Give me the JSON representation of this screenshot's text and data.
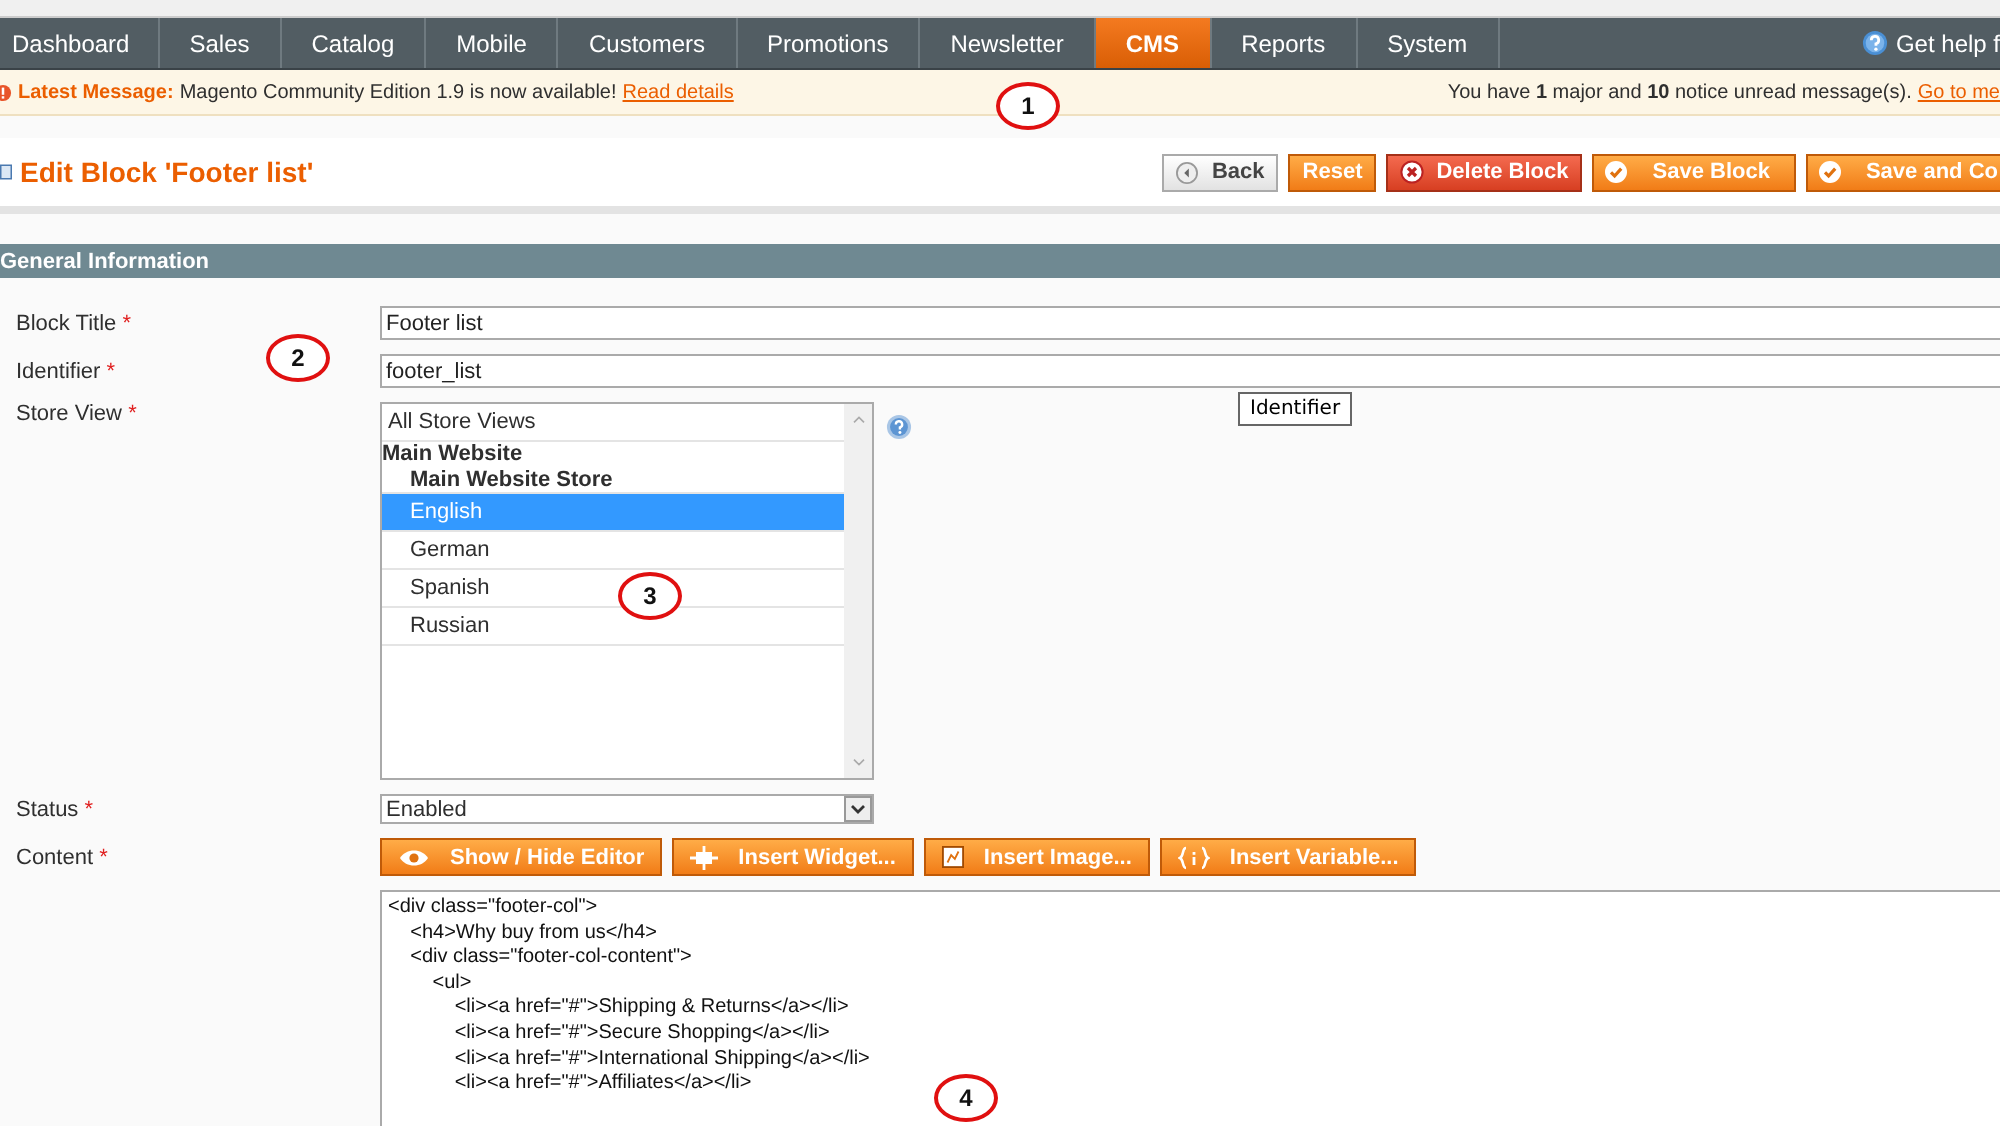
{
  "nav": {
    "items": [
      {
        "label": "Dashboard",
        "selected": false
      },
      {
        "label": "Sales",
        "selected": false
      },
      {
        "label": "Catalog",
        "selected": false
      },
      {
        "label": "Mobile",
        "selected": false
      },
      {
        "label": "Customers",
        "selected": false
      },
      {
        "label": "Promotions",
        "selected": false
      },
      {
        "label": "Newsletter",
        "selected": false
      },
      {
        "label": "CMS",
        "selected": true
      },
      {
        "label": "Reports",
        "selected": false
      },
      {
        "label": "System",
        "selected": false
      }
    ],
    "help": "Get help f"
  },
  "message_bar": {
    "label": "Latest Message:",
    "text": "Magento Community Edition 1.9 is now available!",
    "link": "Read details",
    "notice": "You have **1** major and **10** notice unread message(s).",
    "notice_link": "Go to me"
  },
  "page_title": "Edit Block 'Footer list'",
  "actions": [
    {
      "label": "Back",
      "kind": "back"
    },
    {
      "label": "Reset",
      "kind": "plain"
    },
    {
      "label": "Delete Block",
      "kind": "delete"
    },
    {
      "label": "Save Block",
      "kind": "save"
    },
    {
      "label": "Save and Co",
      "kind": "save"
    }
  ],
  "section_title": "General Information",
  "form": {
    "block_title": {
      "label": "Block Title",
      "required_mark": "*",
      "value": "Footer list"
    },
    "identifier": {
      "label": "Identifier",
      "required_mark": "*",
      "value": "footer_list"
    },
    "store_view": {
      "label": "Store View",
      "required_mark": "*",
      "options": [
        {
          "label": "All Store Views",
          "kind": "option",
          "selected": false
        },
        {
          "label": "Main Website",
          "kind": "group",
          "selected": false
        },
        {
          "label": "Main Website Store",
          "kind": "subgroup",
          "selected": false
        },
        {
          "label": "English",
          "kind": "option",
          "selected": true
        },
        {
          "label": "German",
          "kind": "option",
          "selected": false
        },
        {
          "label": "Spanish",
          "kind": "option",
          "selected": false
        },
        {
          "label": "Russian",
          "kind": "option",
          "selected": false
        }
      ]
    },
    "tooltip": "Identifier",
    "status": {
      "label": "Status",
      "required_mark": "*",
      "value": "Enabled"
    },
    "content": {
      "label": "Content",
      "required_mark": "*",
      "buttons": [
        {
          "label": "Show / Hide Editor",
          "kind": "eye"
        },
        {
          "label": "Insert Widget...",
          "kind": "widget"
        },
        {
          "label": "Insert Image...",
          "kind": "image"
        },
        {
          "label": "Insert Variable...",
          "kind": "variable"
        }
      ],
      "code": [
        "<div class=\"footer-col\">",
        "    <h4>Why buy from us</h4>",
        "    <div class=\"footer-col-content\">",
        "        <ul>",
        "            <li><a href=\"#\">Shipping & Returns</a></li>",
        "            <li><a href=\"#\">Secure Shopping</a></li>",
        "            <li><a href=\"#\">International Shipping</a></li>",
        "            <li><a href=\"#\">Affiliates</a></li>"
      ]
    }
  },
  "callouts": [
    "1",
    "2",
    "3",
    "4"
  ]
}
